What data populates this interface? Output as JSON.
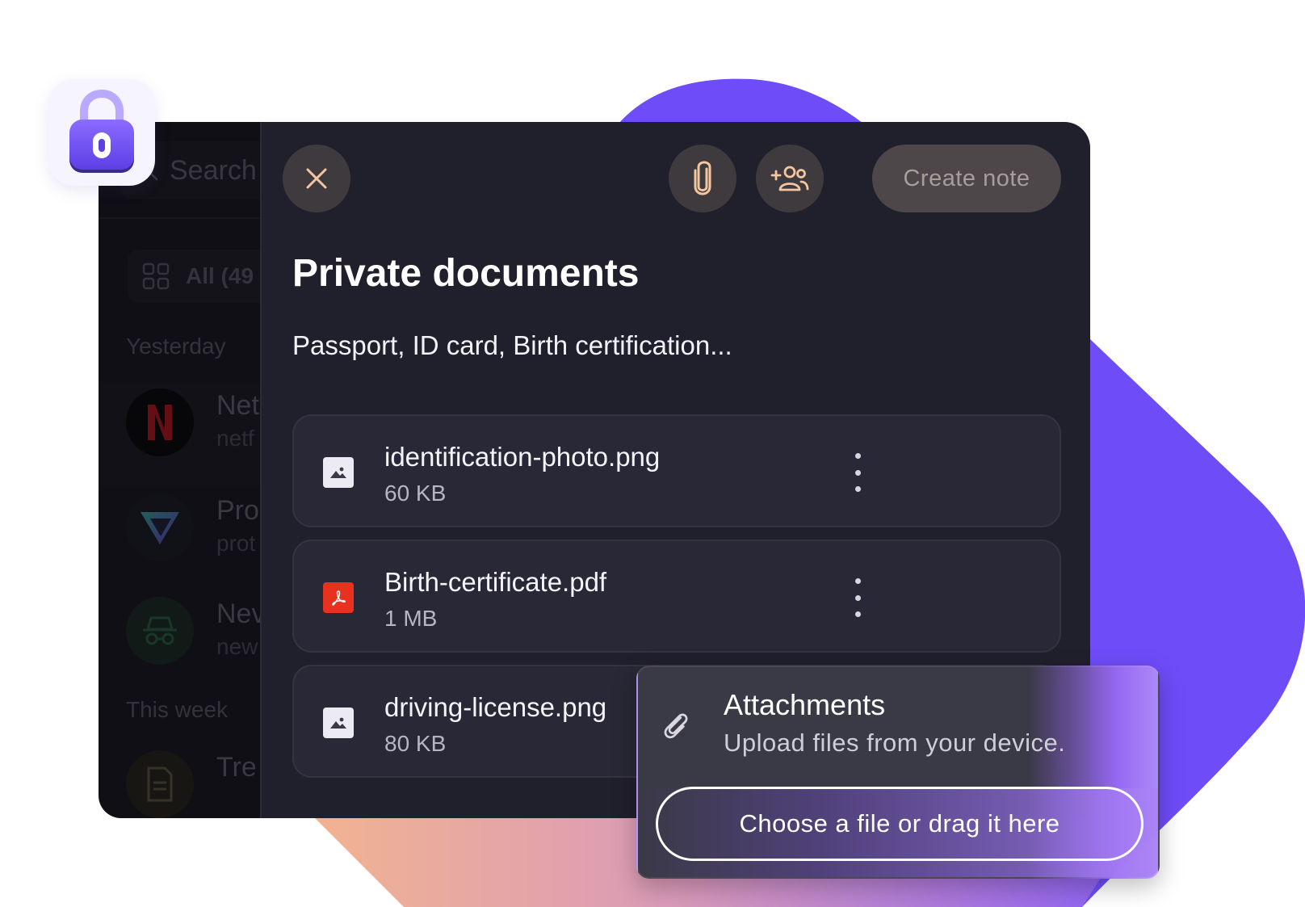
{
  "colors": {
    "accent_purple": "#6d4cf7",
    "panel_bg": "#201f2c",
    "card_bg": "#282836",
    "pdf_red": "#e6321f"
  },
  "sidebar": {
    "search_placeholder": "Search",
    "filter_label": "All (49",
    "section_yesterday": "Yesterday",
    "section_this_week": "This week",
    "items": [
      {
        "title": "Net",
        "subtitle": "netf",
        "icon": "netflix-logo"
      },
      {
        "title": "Pro",
        "subtitle": "prot",
        "icon": "proton-vpn-logo"
      },
      {
        "title": "Nev",
        "subtitle": "new",
        "icon": "incognito-icon"
      },
      {
        "title": "Tre",
        "subtitle": "",
        "icon": "document-icon"
      }
    ]
  },
  "header": {
    "close_icon": "close-icon",
    "attach_icon": "paperclip-icon",
    "share_icon": "users-icon",
    "create_note_label": "Create note"
  },
  "vault": {
    "title": "Private documents",
    "description": "Passport, ID card, Birth certification..."
  },
  "files": [
    {
      "name": "identification-photo.png",
      "size": "60 KB",
      "type": "image"
    },
    {
      "name": "Birth-certificate.pdf",
      "size": "1 MB",
      "type": "pdf"
    },
    {
      "name": "driving-license.png",
      "size": "80 KB",
      "type": "image"
    }
  ],
  "attachments_popover": {
    "title": "Attachments",
    "subtitle": "Upload files from your device.",
    "button_label": "Choose a file or drag it here"
  }
}
